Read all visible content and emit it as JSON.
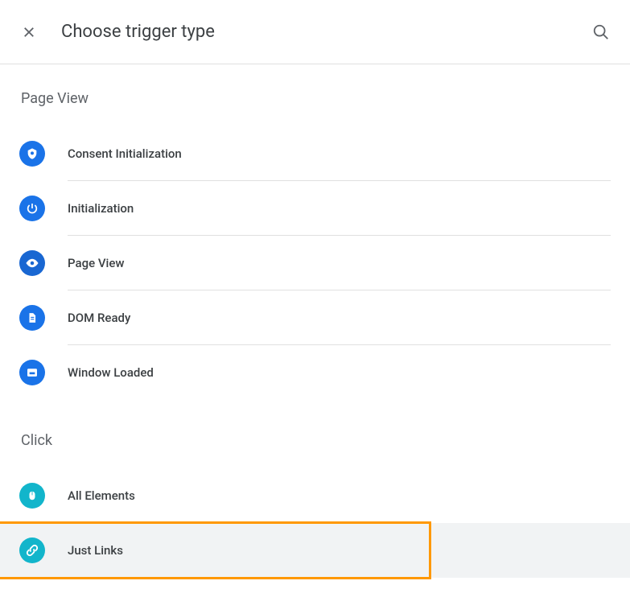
{
  "header": {
    "title": "Choose trigger type"
  },
  "sections": {
    "page_view": {
      "title": "Page View",
      "items": [
        {
          "label": "Consent Initialization",
          "icon": "shield"
        },
        {
          "label": "Initialization",
          "icon": "power"
        },
        {
          "label": "Page View",
          "icon": "eye"
        },
        {
          "label": "DOM Ready",
          "icon": "document"
        },
        {
          "label": "Window Loaded",
          "icon": "window"
        }
      ]
    },
    "click": {
      "title": "Click",
      "items": [
        {
          "label": "All Elements",
          "icon": "mouse"
        },
        {
          "label": "Just Links",
          "icon": "link"
        }
      ]
    }
  }
}
